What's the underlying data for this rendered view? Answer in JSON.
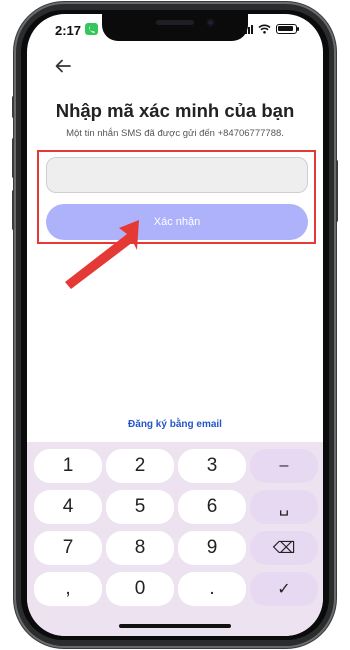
{
  "status_bar": {
    "time": "2:17"
  },
  "header": {
    "back_icon": "arrow-left-icon"
  },
  "main": {
    "title": "Nhập mã xác minh của bạn",
    "subtitle": "Một tin nhắn SMS đã được gửi đến +84706777788.",
    "code_input": {
      "value": "",
      "placeholder": ""
    },
    "confirm_label": "Xác nhận",
    "email_link": "Đăng ký bằng email"
  },
  "keypad": {
    "keys": [
      "1",
      "2",
      "3",
      "–",
      "4",
      "5",
      "6",
      "␣",
      "7",
      "8",
      "9",
      "⌫",
      ",",
      "0",
      ".",
      "✓"
    ]
  },
  "colors": {
    "confirm_button": "#aeb2fa",
    "link": "#2456c8",
    "keypad_bg": "#ede3f0",
    "highlight_box": "#e53935",
    "annotation_arrow": "#e53935"
  }
}
